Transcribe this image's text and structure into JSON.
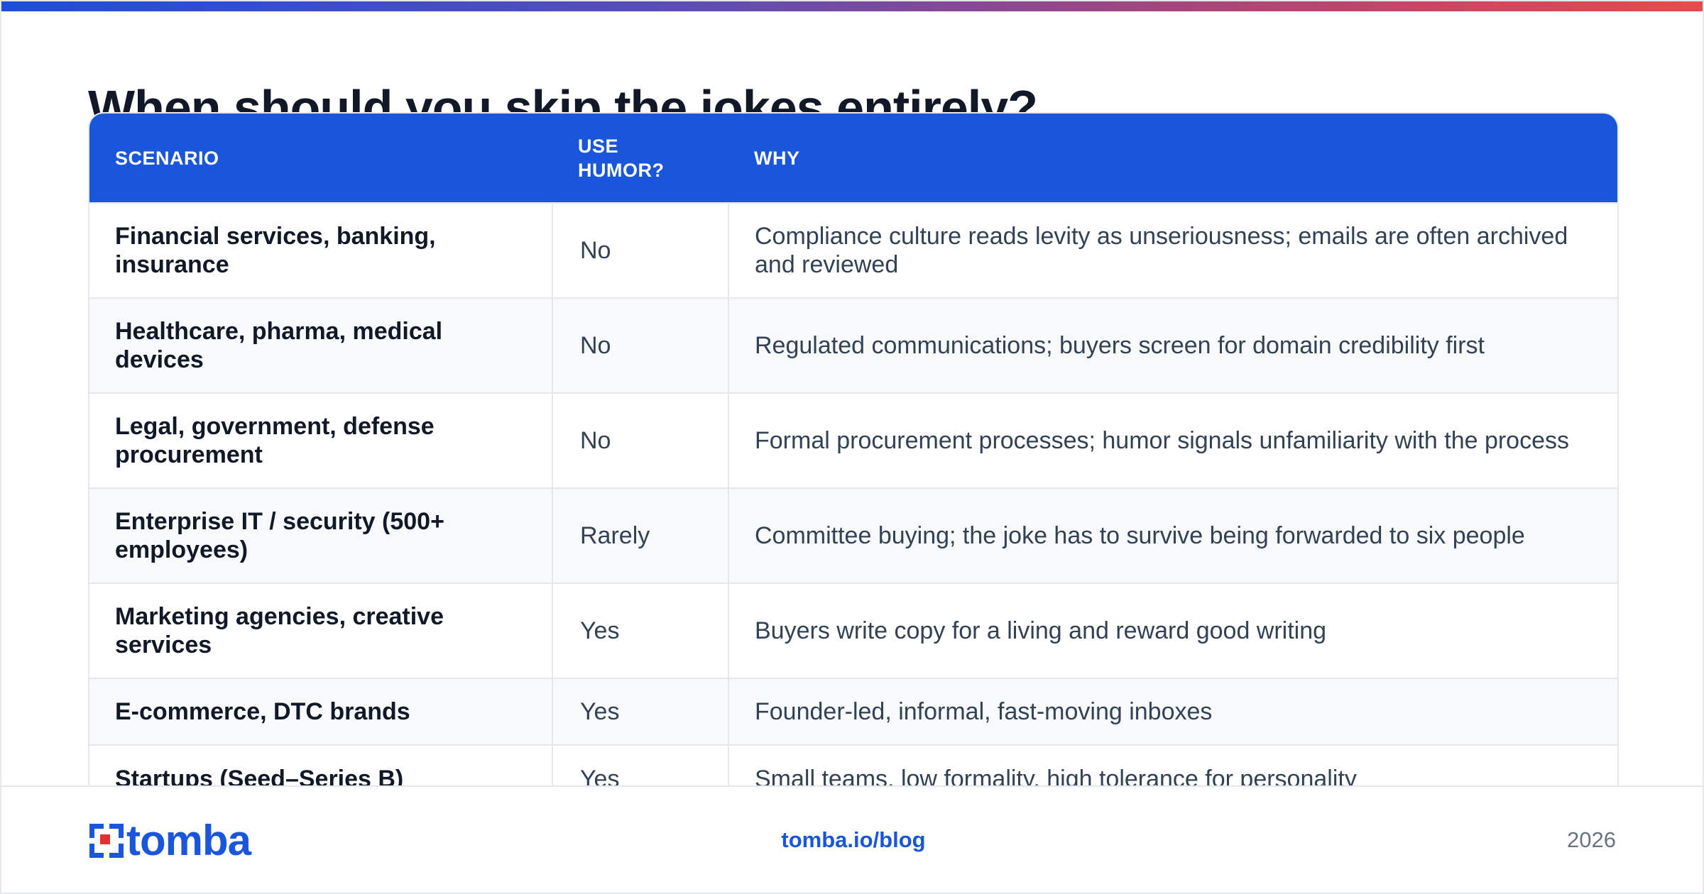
{
  "title": "When should you skip the jokes entirely?",
  "table": {
    "headers": [
      "SCENARIO",
      "USE HUMOR?",
      "WHY"
    ],
    "rows": [
      {
        "scenario": "Financial services, banking, insurance",
        "use_humor": "No",
        "why": "Compliance culture reads levity as unseriousness; emails are often archived and reviewed"
      },
      {
        "scenario": "Healthcare, pharma, medical devices",
        "use_humor": "No",
        "why": "Regulated communications; buyers screen for domain credibility first"
      },
      {
        "scenario": "Legal, government, defense procurement",
        "use_humor": "No",
        "why": "Formal procurement processes; humor signals unfamiliarity with the process"
      },
      {
        "scenario": "Enterprise IT / security (500+ employees)",
        "use_humor": "Rarely",
        "why": "Committee buying; the joke has to survive being forwarded to six people"
      },
      {
        "scenario": "Marketing agencies, creative services",
        "use_humor": "Yes",
        "why": "Buyers write copy for a living and reward good writing"
      },
      {
        "scenario": "E-commerce, DTC brands",
        "use_humor": "Yes",
        "why": "Founder-led, informal, fast-moving inboxes"
      },
      {
        "scenario": "Startups (Seed–Series B)",
        "use_humor": "Yes",
        "why": "Small teams, low formality, high tolerance for personality"
      }
    ]
  },
  "footer": {
    "logo_text": "tomba",
    "logo_icon": "tomba-logo-icon",
    "link": "tomba.io/blog",
    "year": "2026"
  },
  "colors": {
    "brand_blue": "#1a56db",
    "header_bg": "#1a56db",
    "accent_gradient": [
      "#1d4ed8",
      "#e84a4a"
    ]
  }
}
